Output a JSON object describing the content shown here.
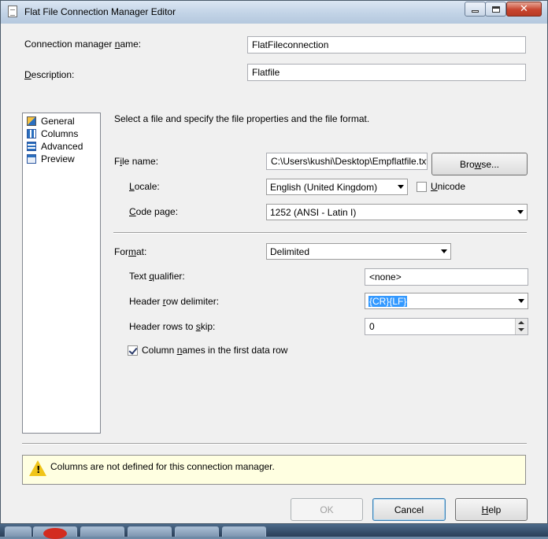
{
  "window": {
    "title": "Flat File Connection Manager Editor"
  },
  "fields": {
    "connection_manager_name_label_pre": "Connection manager ",
    "connection_manager_name_label_ul": "n",
    "connection_manager_name_label_post": "ame:",
    "connection_manager_name_value": "FlatFileconnection",
    "description_label_pre": "",
    "description_label_ul": "D",
    "description_label_post": "escription:",
    "description_value": "Flatfile"
  },
  "nav": {
    "items": [
      {
        "label": "General",
        "icon": "general-icon"
      },
      {
        "label": "Columns",
        "icon": "columns-icon"
      },
      {
        "label": "Advanced",
        "icon": "advanced-icon"
      },
      {
        "label": "Preview",
        "icon": "preview-icon"
      }
    ]
  },
  "general": {
    "instructions": "Select a file and specify the file properties and the file format.",
    "file_name_label_pre": "F",
    "file_name_label_ul": "i",
    "file_name_label_post": "le name:",
    "file_name_value": "C:\\Users\\kushi\\Desktop\\Empflatfile.txt",
    "browse_pre": "Bro",
    "browse_ul": "w",
    "browse_post": "se...",
    "locale_label_pre": "",
    "locale_label_ul": "L",
    "locale_label_post": "ocale:",
    "locale_value": "English (United Kingdom)",
    "unicode_label_pre": "",
    "unicode_label_ul": "U",
    "unicode_label_post": "nicode",
    "unicode_checked": false,
    "code_page_label_pre": "",
    "code_page_label_ul": "C",
    "code_page_label_post": "ode page:",
    "code_page_value": "1252  (ANSI - Latin I)",
    "format_label_pre": "For",
    "format_label_ul": "m",
    "format_label_post": "at:",
    "format_value": "Delimited",
    "text_qualifier_label_pre": "Text ",
    "text_qualifier_label_ul": "q",
    "text_qualifier_label_post": "ualifier:",
    "text_qualifier_value": "<none>",
    "header_row_delimiter_label_pre": "Header ",
    "header_row_delimiter_label_ul": "r",
    "header_row_delimiter_label_post": "ow delimiter:",
    "header_row_delimiter_value": "{CR}{LF}",
    "header_rows_to_skip_label_pre": "Header rows to ",
    "header_rows_to_skip_label_ul": "s",
    "header_rows_to_skip_label_post": "kip:",
    "header_rows_to_skip_value": "0",
    "column_names_label_pre": "Column ",
    "column_names_label_ul": "n",
    "column_names_label_post": "ames in the first data row",
    "column_names_checked": true
  },
  "status": {
    "message": "Columns are not defined for this connection manager.",
    "icon": "warning-icon"
  },
  "buttons": {
    "ok": "OK",
    "cancel": "Cancel",
    "help_ul": "H",
    "help_post": "elp"
  }
}
